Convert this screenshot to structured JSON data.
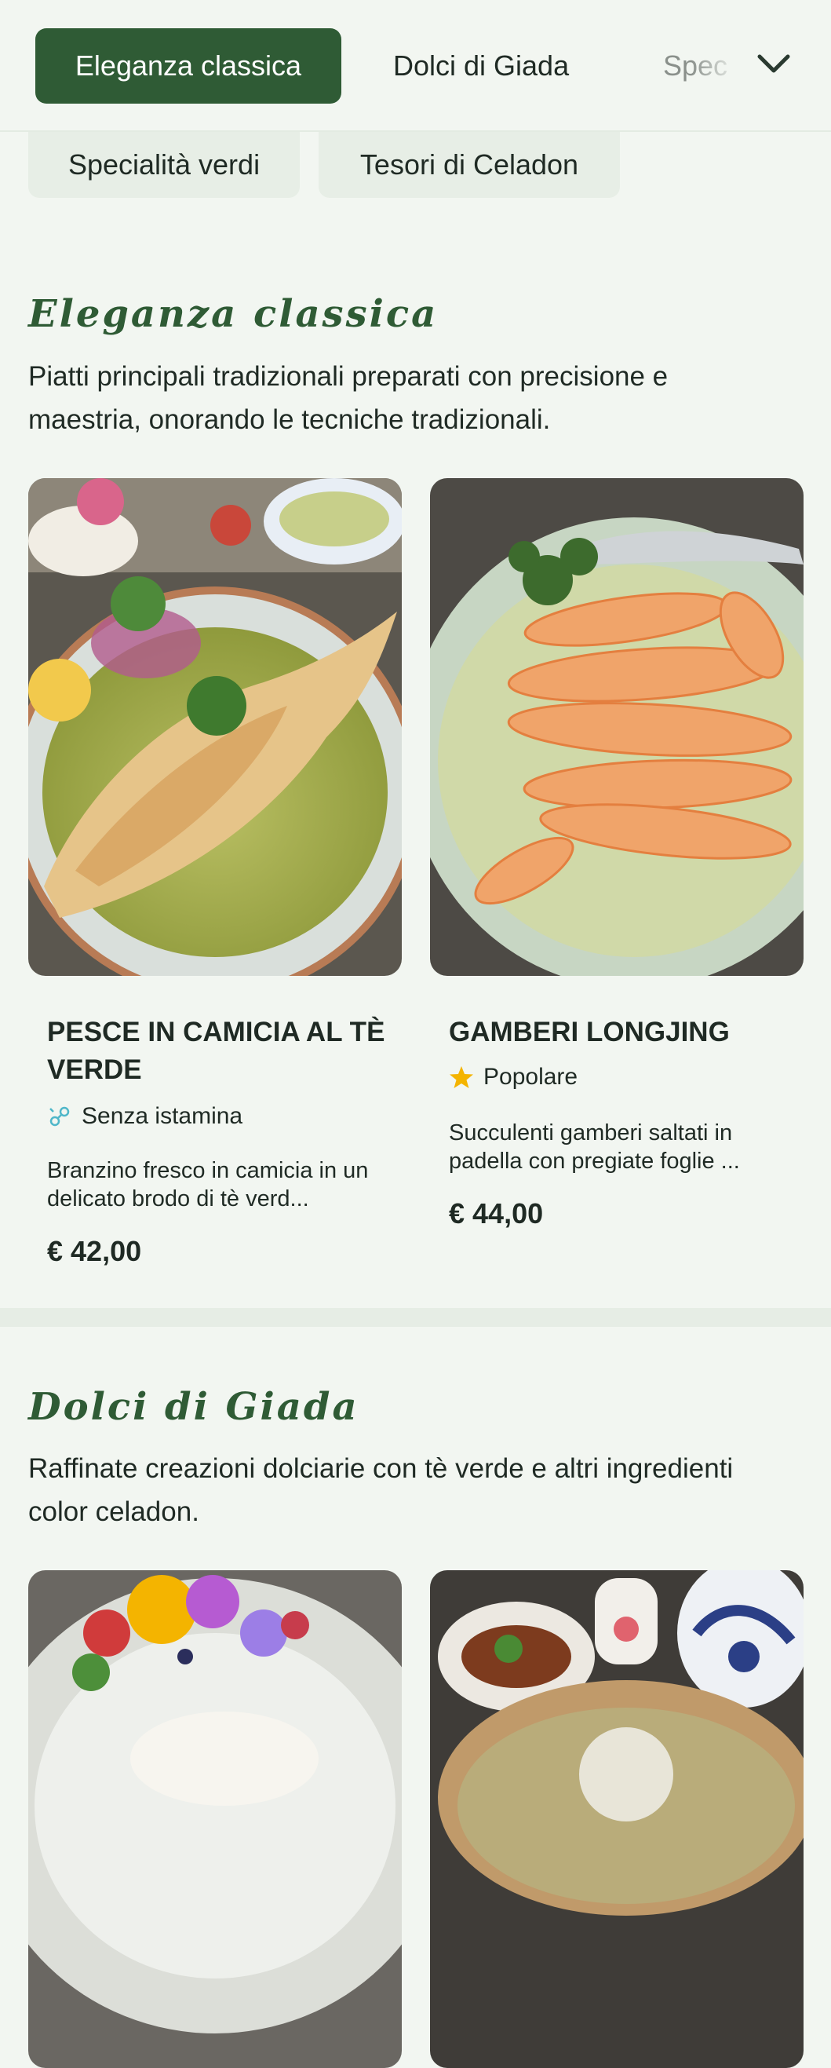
{
  "nav": {
    "tabs": [
      {
        "label": "Eleganza classica",
        "active": true
      },
      {
        "label": "Dolci di Giada",
        "active": false
      },
      {
        "label": "Spec",
        "active": false
      }
    ],
    "chips": [
      {
        "label": "Specialità verdi"
      },
      {
        "label": "Tesori di Celadon"
      }
    ],
    "expand_icon": "chevron-down-icon"
  },
  "sections": [
    {
      "title": "Eleganza classica",
      "description": "Piatti principali tradizionali preparati con precisione e maestria, onorando le tecniche tradizionali.",
      "dishes": [
        {
          "name": "PESCE IN CAMICIA AL TÈ VERDE",
          "badge_icon": "antihistamine-icon",
          "badge": "Senza istamina",
          "description": "Branzino fresco in camicia in un delicato brodo di tè verd...",
          "price": "€ 42,00"
        },
        {
          "name": "GAMBERI LONGJING",
          "badge_icon": "star-icon",
          "badge": "Popolare",
          "description": "Succulenti gamberi saltati in padella con pregiate foglie ...",
          "price": "€ 44,00"
        }
      ]
    },
    {
      "title": "Dolci di Giada",
      "description": "Raffinate creazioni dolciarie con tè verde e altri ingredienti color celadon."
    }
  ],
  "colors": {
    "accent": "#2f5b35",
    "background": "#f2f6f1",
    "star": "#f4b400",
    "badge_teal": "#4fb7c9"
  }
}
